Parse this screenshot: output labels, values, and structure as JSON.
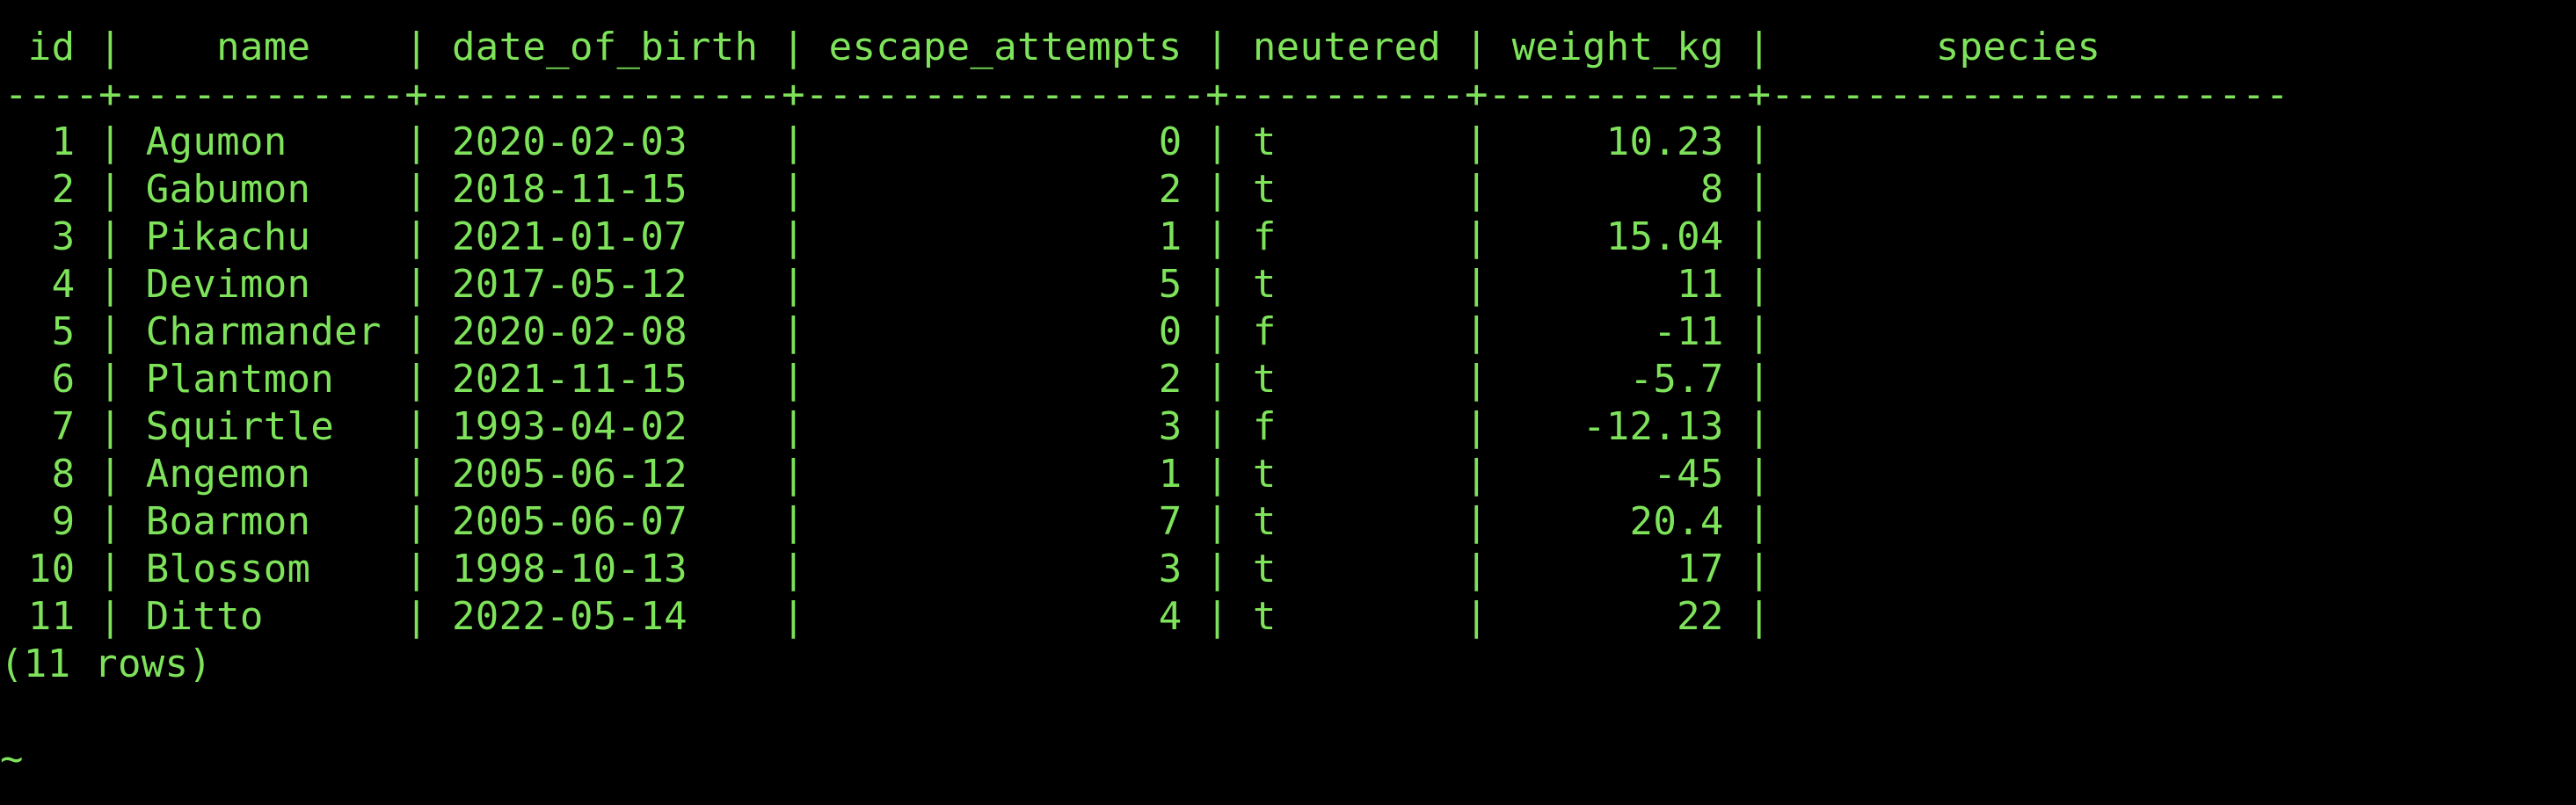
{
  "terminal": {
    "text_color": "#7ee35a",
    "background_color": "#000000",
    "header": " id |    name    | date_of_birth | escape_attempts | neutered | weight_kg |       species",
    "separator": "----+------------+---------------+-----------------+----------+-----------+----------------------",
    "rows": [
      "  1 | Agumon     | 2020-02-03    |               0 | t        |     10.23 |",
      "  2 | Gabumon    | 2018-11-15    |               2 | t        |         8 |",
      "  3 | Pikachu    | 2021-01-07    |               1 | f        |     15.04 |",
      "  4 | Devimon    | 2017-05-12    |               5 | t        |        11 |",
      "  5 | Charmander | 2020-02-08    |               0 | f        |       -11 |",
      "  6 | Plantmon   | 2021-11-15    |               2 | t        |      -5.7 |",
      "  7 | Squirtle   | 1993-04-02    |               3 | f        |    -12.13 |",
      "  8 | Angemon    | 2005-06-12    |               1 | t        |       -45 |",
      "  9 | Boarmon    | 2005-06-07    |               7 | t        |      20.4 |",
      " 10 | Blossom    | 1998-10-13    |               3 | t        |        17 |",
      " 11 | Ditto      | 2022-05-14    |               4 | t        |        22 |"
    ],
    "footer": "(11 rows)",
    "pager_marker": "~"
  }
}
